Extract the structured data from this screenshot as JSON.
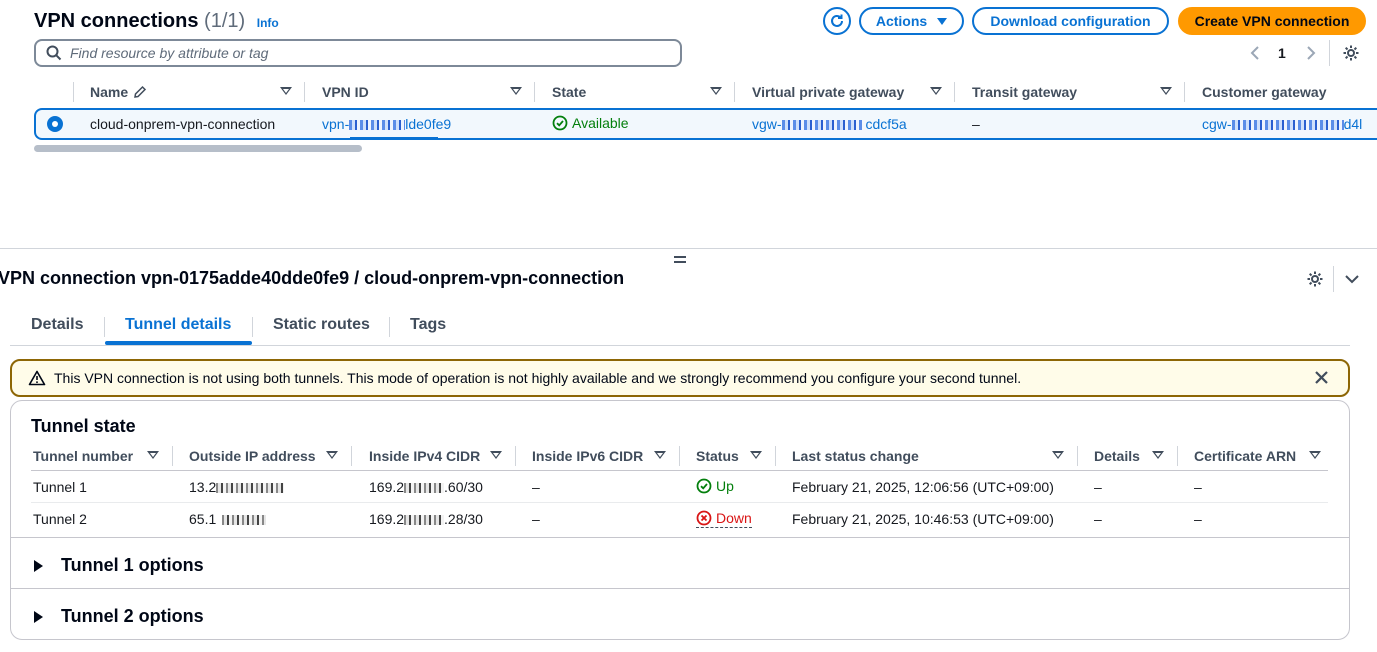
{
  "header": {
    "title": "VPN connections",
    "count": "(1/1)",
    "info": "Info",
    "actions_label": "Actions",
    "download_label": "Download configuration",
    "create_label": "Create VPN connection"
  },
  "search": {
    "placeholder": "Find resource by attribute or tag"
  },
  "pagination": {
    "page": "1"
  },
  "table": {
    "columns": [
      "Name",
      "VPN ID",
      "State",
      "Virtual private gateway",
      "Transit gateway",
      "Customer gateway"
    ],
    "row": {
      "name": "cloud-onprem-vpn-connection",
      "vpn_id_prefix": "vpn-",
      "vpn_id_suffix": "lde0fe9",
      "state": "Available",
      "vgw_prefix": "vgw-",
      "vgw_suffix": "cdcf5a",
      "transit_gateway": "–",
      "cgw_prefix": "cgw-",
      "cgw_suffix": "d4l"
    }
  },
  "panel": {
    "title": "VPN connection vpn-0175adde40dde0fe9 / cloud-onprem-vpn-connection",
    "tabs": [
      "Details",
      "Tunnel details",
      "Static routes",
      "Tags"
    ],
    "active_tab": "Tunnel details",
    "alert": "This VPN connection is not using both tunnels. This mode of operation is not highly available and we strongly recommend you configure your second tunnel.",
    "tunnel_state_title": "Tunnel state",
    "tunnel_columns": [
      "Tunnel number",
      "Outside IP address",
      "Inside IPv4 CIDR",
      "Inside IPv6 CIDR",
      "Status",
      "Last status change",
      "Details",
      "Certificate ARN"
    ],
    "tunnels": [
      {
        "number": "Tunnel 1",
        "outside_ip_prefix": "13.2",
        "inside_ipv4_prefix": "169.2",
        "inside_ipv4_suffix": ".60/30",
        "inside_ipv6": "–",
        "status": "Up",
        "last_change": "February 21, 2025, 12:06:56 (UTC+09:00)",
        "details": "–",
        "cert_arn": "–"
      },
      {
        "number": "Tunnel 2",
        "outside_ip_prefix": "65.1",
        "inside_ipv4_prefix": "169.2",
        "inside_ipv4_suffix": ".28/30",
        "inside_ipv6": "–",
        "status": "Down",
        "last_change": "February 21, 2025, 10:46:53 (UTC+09:00)",
        "details": "–",
        "cert_arn": "–"
      }
    ],
    "tunnel1_options": "Tunnel 1 options",
    "tunnel2_options": "Tunnel 2 options"
  },
  "colors": {
    "accent": "#0972d3",
    "primary_button": "#ff9900",
    "success": "#037f0c",
    "error": "#d91515",
    "warning_border": "#8d6605"
  },
  "icons": [
    "refresh-icon",
    "pencil-icon",
    "check-circle-icon",
    "x-circle-icon",
    "warning-icon",
    "close-icon",
    "gear-icon",
    "chevron-down-icon",
    "chevron-left-icon",
    "chevron-right-icon"
  ]
}
